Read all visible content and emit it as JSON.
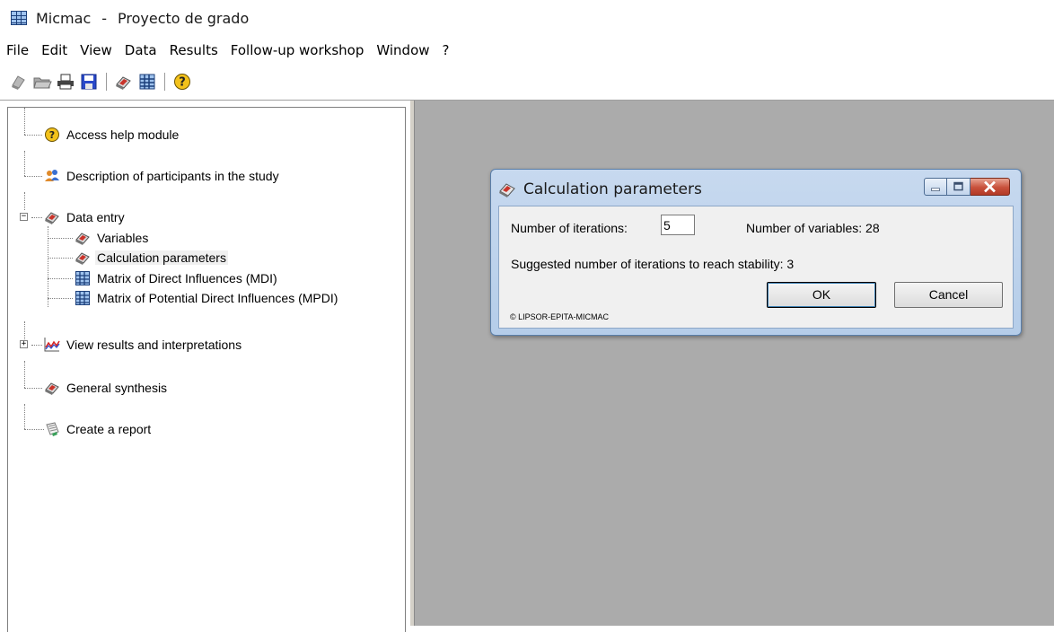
{
  "window": {
    "app_name": "Micmac",
    "separator": "-",
    "project_name": "Proyecto de grado"
  },
  "menu": {
    "items": [
      "File",
      "Edit",
      "View",
      "Data",
      "Results",
      "Follow-up workshop",
      "Window",
      "?"
    ]
  },
  "toolbar": {
    "buttons": [
      "new-icon",
      "open-icon",
      "print-icon",
      "save-icon",
      "data-icon",
      "matrix-icon",
      "help-icon"
    ]
  },
  "tree": {
    "help": "Access help module",
    "participants": "Description of participants in the study",
    "data_entry": "Data entry",
    "variables": "Variables",
    "calc_params": "Calculation parameters",
    "mdi": "Matrix of Direct Influences (MDI)",
    "mpdi": "Matrix of Potential Direct Influences (MPDI)",
    "results": "View results and interpretations",
    "synthesis": "General synthesis",
    "report": "Create a report",
    "selected": "Calculation parameters"
  },
  "dialog": {
    "title": "Calculation parameters",
    "iterations_label": "Number of iterations:",
    "iterations_value": "5",
    "variables_label": "Number of variables: 28",
    "suggested_label": "Suggested number of iterations to reach stability: 3",
    "ok_label": "OK",
    "cancel_label": "Cancel",
    "copyright": "© LIPSOR-EPITA-MICMAC"
  },
  "colors": {
    "workspace": "#ababab",
    "dialog_frame": "#b5cde9",
    "close_button": "#c8503b"
  }
}
